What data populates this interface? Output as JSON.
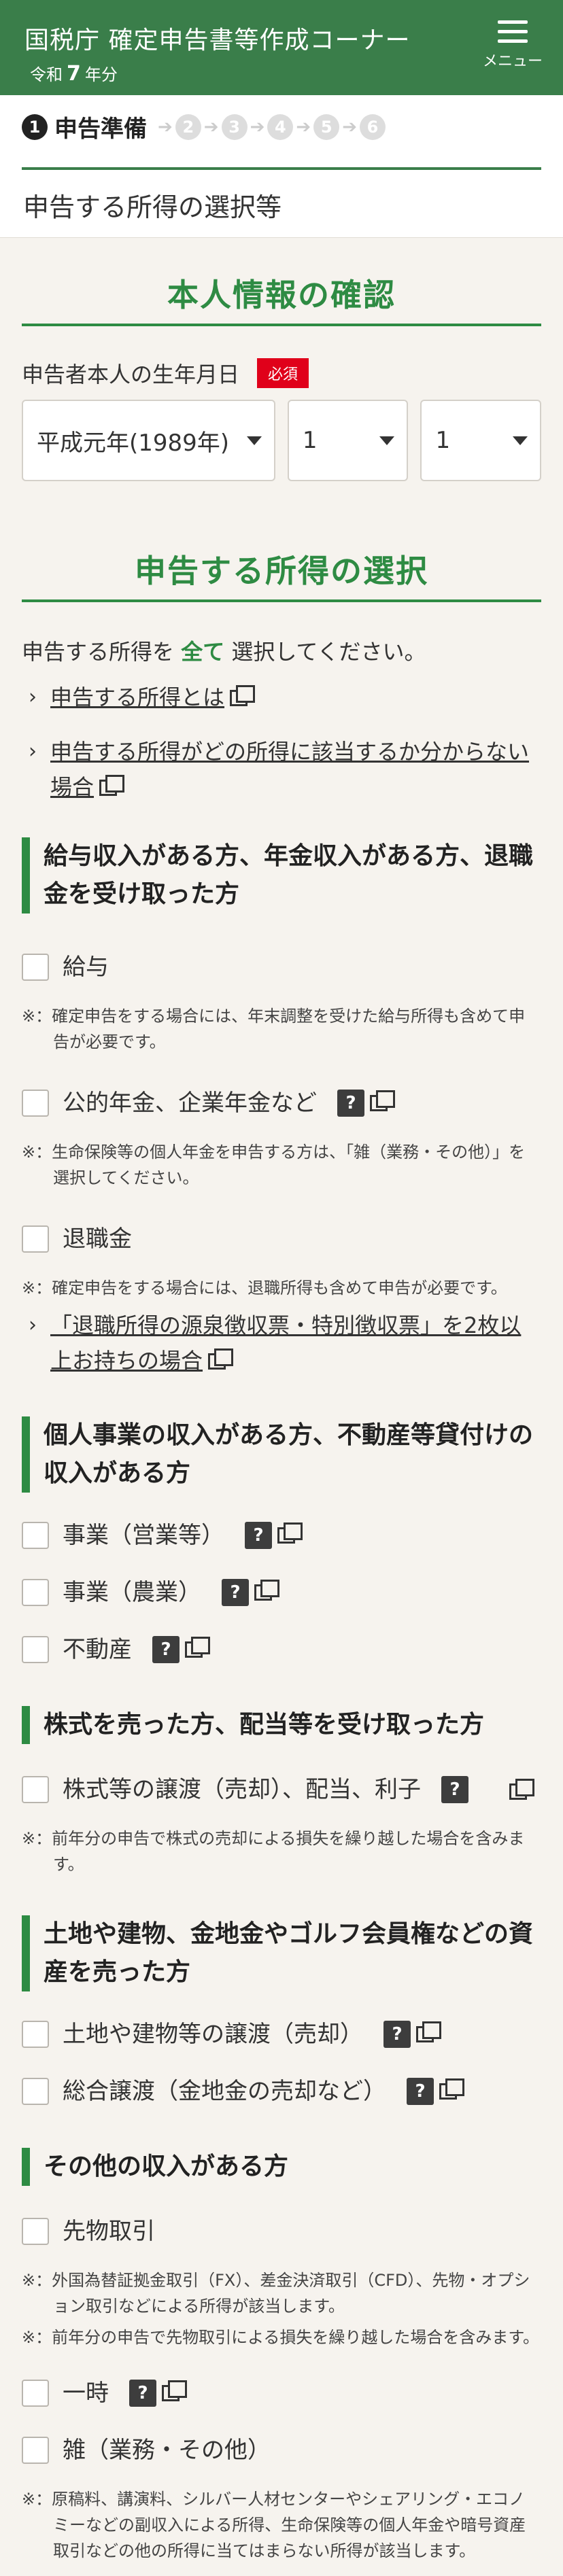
{
  "header": {
    "title": "国税庁 確定申告書等作成コーナー",
    "year_prefix": "令和",
    "year_num": "7",
    "year_suffix": "年分",
    "menu_label": "メニュー"
  },
  "steps": {
    "current_num": "1",
    "current_label": "申告準備",
    "others": [
      "2",
      "3",
      "4",
      "5",
      "6"
    ]
  },
  "page_title": "申告する所得の選択等",
  "personal": {
    "heading": "本人情報の確認",
    "birth_label": "申告者本人の生年月日",
    "required": "必須",
    "era": "平成元年(1989年)",
    "month": "1",
    "day": "1"
  },
  "income": {
    "heading": "申告する所得の選択",
    "lead_pre": "申告する所得を",
    "lead_em": "全て",
    "lead_post": "選択してください。",
    "link1": "申告する所得とは",
    "link2": "申告する所得がどの所得に該当するか分からない場合",
    "cat1": "給与収入がある方、年金収入がある方、退職金を受け取った方",
    "kyuyo": "給与",
    "note_kyuyo": "※：確定申告をする場合には、年末調整を受けた給与所得も含めて申告が必要です。",
    "nenkin": "公的年金、企業年金など",
    "note_nenkin": "※：生命保険等の個人年金を申告する方は、「雑（業務・その他）」を選択してください。",
    "taishoku": "退職金",
    "note_taishoku": "※：確定申告をする場合には、退職所得も含めて申告が必要です。",
    "link3": "「退職所得の源泉徴収票・特別徴収票」を2枚以上お持ちの場合",
    "cat2": "個人事業の収入がある方、不動産等貸付けの収入がある方",
    "eigyo": "事業（営業等）",
    "nogyo": "事業（農業）",
    "fudosan": "不動産",
    "cat3": "株式を売った方、配当等を受け取った方",
    "kabu": "株式等の譲渡（売却）、配当、利子",
    "note_kabu": "※：前年分の申告で株式の売却による損失を繰り越した場合を含みます。",
    "cat4": "土地や建物、金地金やゴルフ会員権などの資産を売った方",
    "tochi": "土地や建物等の譲渡（売却）",
    "sogo": "総合譲渡（金地金の売却など）",
    "cat5": "その他の収入がある方",
    "sakimono": "先物取引",
    "note_sakimono1": "※：外国為替証拠金取引（FX）、差金決済取引（CFD）、先物・オプション取引などによる所得が該当します。",
    "note_sakimono2": "※：前年分の申告で先物取引による損失を繰り越した場合を含みます。",
    "ichiji": "一時",
    "zatsu": "雑（業務・その他）",
    "note_zatsu": "※：原稿料、講演料、シルバー人材センターやシェアリング・エコノミーなどの副収入による所得、生命保険等の個人年金や暗号資産取引などの他の所得に当てはまらない所得が該当します。",
    "help_glyph": "?"
  }
}
